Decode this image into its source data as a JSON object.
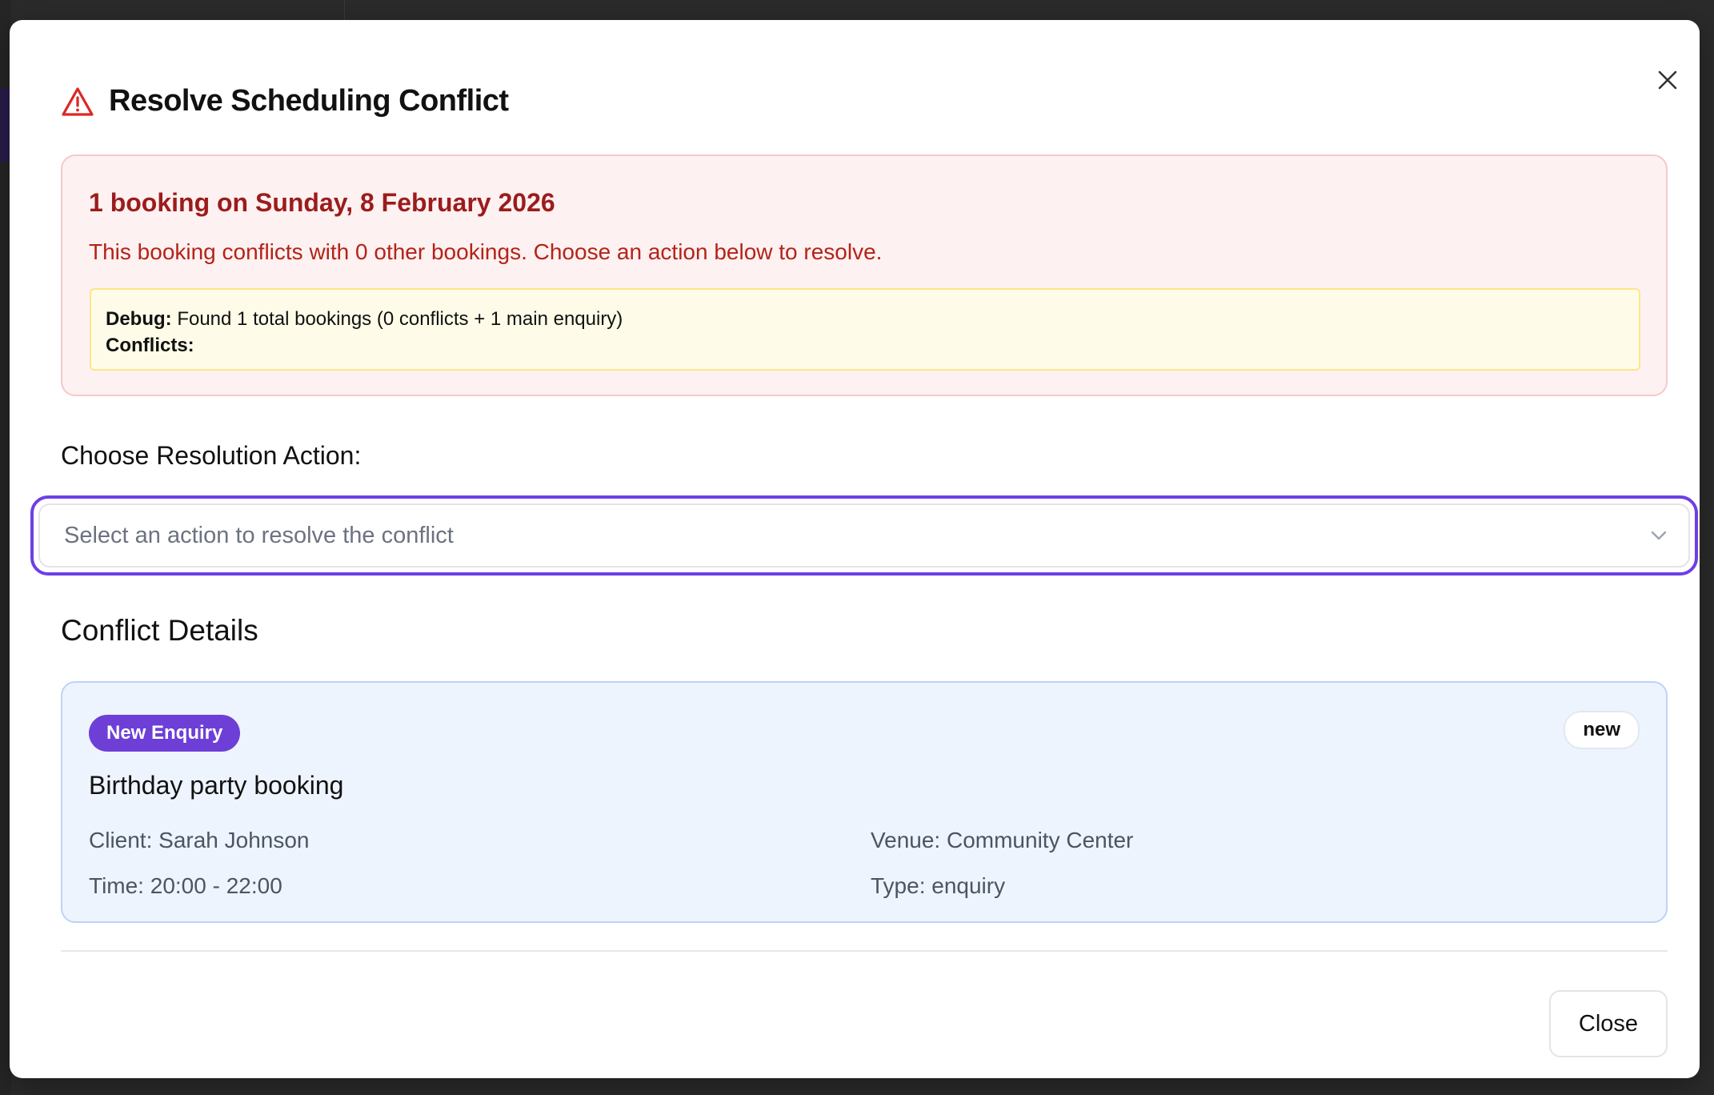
{
  "modal": {
    "title": "Resolve Scheduling Conflict",
    "title_icon": "warning-triangle-icon",
    "close_icon": "close-icon"
  },
  "alert": {
    "title": "1 booking on Sunday, 8 February 2026",
    "message": "This booking conflicts with 0 other bookings. Choose an action below to resolve.",
    "debug": {
      "label": "Debug:",
      "text": "Found 1 total bookings (0 conflicts + 1 main enquiry)",
      "conflicts_label": "Conflicts:",
      "conflicts_value": ""
    }
  },
  "resolution": {
    "label": "Choose Resolution Action:",
    "placeholder": "Select an action to resolve the conflict",
    "chevron_icon": "chevron-down-icon"
  },
  "details": {
    "heading": "Conflict Details",
    "booking": {
      "type_badge": "New Enquiry",
      "status_badge": "new",
      "title": "Birthday party booking",
      "client": "Client: Sarah Johnson",
      "venue": "Venue: Community Center",
      "time": "Time: 20:00 - 22:00",
      "type": "Type: enquiry"
    }
  },
  "footer": {
    "close_label": "Close"
  },
  "colors": {
    "accent": "#6d3fe6",
    "alert_bg": "#fdf1f1",
    "alert_text": "#9b1c1c",
    "debug_bg": "#fefce8",
    "card_bg": "#eef4fd",
    "warning_icon": "#dc2626"
  }
}
